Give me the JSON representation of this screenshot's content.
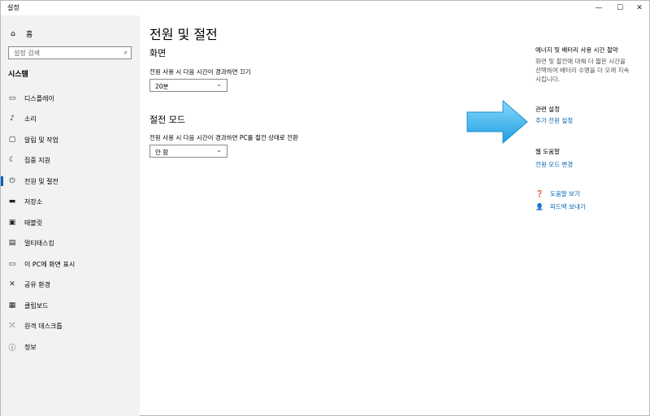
{
  "window": {
    "title": "설정",
    "controls": {
      "minimize": "—",
      "maximize": "☐",
      "close": "✕"
    }
  },
  "sidebar": {
    "home": {
      "icon": "home-icon",
      "label": "홈"
    },
    "search": {
      "placeholder": "설정 검색",
      "icon": "search-icon"
    },
    "section": "시스템",
    "items": [
      {
        "icon": "monitor-icon",
        "label": "디스플레이"
      },
      {
        "icon": "speaker-icon",
        "label": "소리"
      },
      {
        "icon": "notification-icon",
        "label": "알림 및 작업"
      },
      {
        "icon": "focus-assist-icon",
        "label": "집중 지원"
      },
      {
        "icon": "power-icon",
        "label": "전원 및 절전",
        "selected": true
      },
      {
        "icon": "storage-icon",
        "label": "저장소"
      },
      {
        "icon": "tablet-icon",
        "label": "태블릿"
      },
      {
        "icon": "multitasking-icon",
        "label": "멀티태스킹"
      },
      {
        "icon": "project-icon",
        "label": "이 PC에 화면 표시"
      },
      {
        "icon": "shared-experience-icon",
        "label": "공유 환경"
      },
      {
        "icon": "clipboard-icon",
        "label": "클립보드"
      },
      {
        "icon": "remote-desktop-icon",
        "label": "원격 데스크톱"
      },
      {
        "icon": "info-icon",
        "label": "정보"
      }
    ]
  },
  "main": {
    "title": "전원 및 절전",
    "screen": {
      "heading": "화면",
      "label": "전원 사용 시 다음 시간이 경과하면 끄기",
      "value": "20분"
    },
    "sleep": {
      "heading": "절전 모드",
      "label": "전원 사용 시 다음 시간이 경과하면 PC를 절전 상태로 전환",
      "value": "안 함"
    }
  },
  "right": {
    "energy": {
      "title": "에너지 및 배터리 사용 시간 절약",
      "lines": [
        "화면 및 절전에 대해 더 짧은 시간을",
        "선택하여 배터리 수명을 더 오래 지속",
        "시킵니다."
      ]
    },
    "related": {
      "title": "관련 설정",
      "link": "추가 전원 설정"
    },
    "web_help": {
      "title": "웹 도움말",
      "link": "전원 모드 변경"
    },
    "help": {
      "icon": "help-icon",
      "label": "도움말 보기"
    },
    "feedback": {
      "icon": "feedback-icon",
      "label": "피드백 보내기"
    }
  },
  "colors": {
    "accent": "#0063b1",
    "sidebar_bg": "#f2f2f2",
    "arrow": "#3fb8f0"
  }
}
